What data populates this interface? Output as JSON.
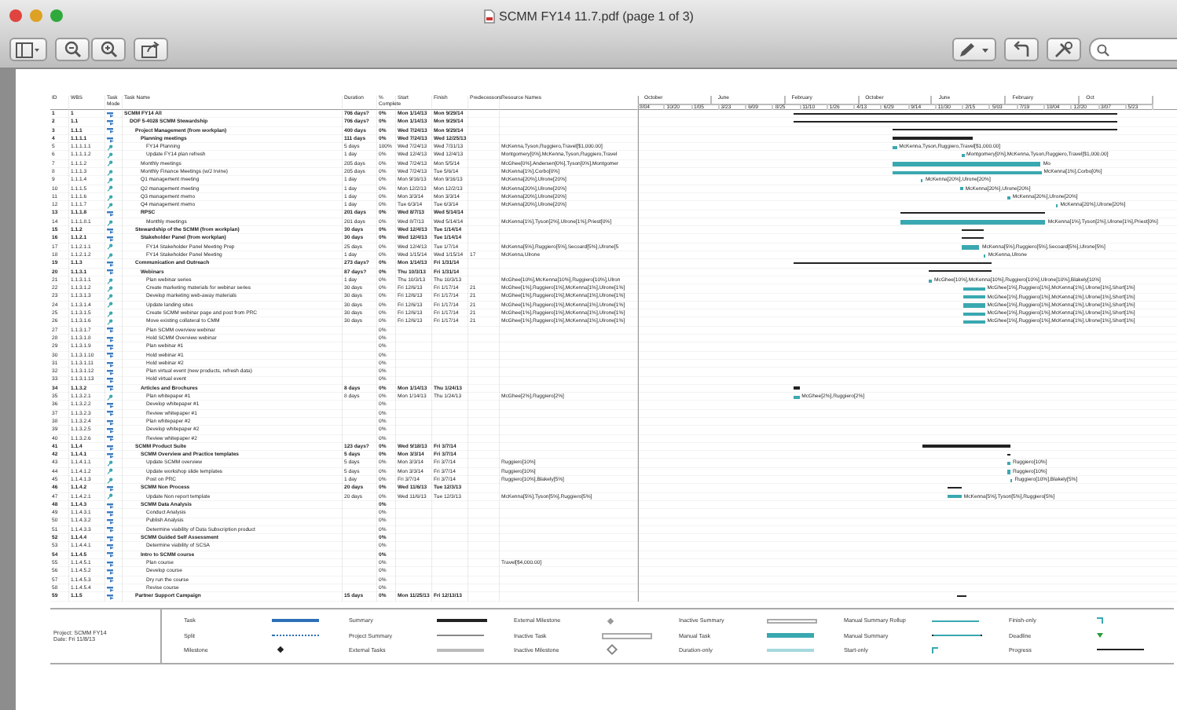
{
  "window": {
    "title": "SCMM FY14 11.7.pdf (page 1 of 3)"
  },
  "table": {
    "columns": {
      "id": "ID",
      "wbs": "WBS",
      "mode": "Task Mode",
      "name": "Task Name",
      "duration": "Duration",
      "complete": "% Complete",
      "start": "Start",
      "finish": "Finish",
      "pred": "Predecessors",
      "resources": "Resource Names"
    },
    "timescale": {
      "major": [
        "October",
        "June",
        "February",
        "October",
        "June",
        "February",
        "Oct"
      ],
      "minor": [
        "8/04",
        "10/20",
        "1/05",
        "3/23",
        "6/09",
        "8/25",
        "11/10",
        "1/26",
        "4/13",
        "6/29",
        "9/14",
        "11/30",
        "2/15",
        "5/03",
        "7/19",
        "10/04",
        "12/20",
        "3/07",
        "5/23"
      ]
    },
    "tasks": [
      {
        "id": "1",
        "wbs": "1",
        "kind": "auto",
        "name": "SCMM FY14 All",
        "duration": "706 days?",
        "complete": "0%",
        "start": "Mon 1/14/13",
        "finish": "Mon 9/29/14",
        "children": [
          {
            "id": "2",
            "wbs": "1.1",
            "kind": "auto",
            "name": "DOF 5-4028 SCMM Stewardship",
            "duration": "706 days?",
            "complete": "0%",
            "start": "Mon 1/14/13",
            "finish": "Mon 9/29/14",
            "children": [
              {
                "id": "3",
                "wbs": "1.1.1",
                "kind": "auto",
                "name": "Project Management (from workplan)",
                "duration": "400 days",
                "complete": "0%",
                "start": "Wed 7/24/13",
                "finish": "Mon 9/29/14",
                "children": [
                  {
                    "id": "4",
                    "wbs": "1.1.1.1",
                    "kind": "auto",
                    "name": "Planning meetings",
                    "duration": "111 days",
                    "complete": "0%",
                    "start": "Wed 7/24/13",
                    "finish": "Wed 12/25/13",
                    "children": [
                      {
                        "id": "5",
                        "wbs": "1.1.1.1.1",
                        "kind": "manual",
                        "name": "FY14 Planning",
                        "duration": "5 days",
                        "complete": "100%",
                        "start": "Wed 7/24/13",
                        "finish": "Wed 7/31/13",
                        "resources": "McKenna,Tyson,Ruggiero,Travel[$1,000.00]",
                        "bar_label": "McKenna,Tyson,Ruggiero,Travel[$1,000.00]"
                      },
                      {
                        "id": "6",
                        "wbs": "1.1.1.1.2",
                        "kind": "manual",
                        "name": "Update FY14 plan refresh",
                        "duration": "1 day",
                        "complete": "0%",
                        "start": "Wed 12/4/13",
                        "finish": "Wed 12/4/13",
                        "resources": "Montgomery[0%],McKenna,Tyson,Ruggiero,Travel",
                        "bar_label": "Montgomery[0%],McKenna,Tyson,Ruggiero,Travel[$1,000.00]"
                      }
                    ]
                  },
                  {
                    "id": "7",
                    "wbs": "1.1.1.2",
                    "kind": "manual",
                    "name": "Monthly meetings",
                    "duration": "205 days",
                    "complete": "0%",
                    "start": "Wed 7/24/13",
                    "finish": "Mon 5/5/14",
                    "resources": "McGhee[0%],Andersen[0%],Tyson[0%],Montgomer",
                    "bar_label": "Mo"
                  },
                  {
                    "id": "8",
                    "wbs": "1.1.1.3",
                    "kind": "manual",
                    "name": "Monthly Finance Meetings (w/J Irvine)",
                    "duration": "205 days",
                    "complete": "0%",
                    "start": "Wed 7/24/13",
                    "finish": "Tue 5/6/14",
                    "resources": "McKenna[1%],Corbo[0%]",
                    "bar_label": "McKenna[1%],Corbo[0%]"
                  },
                  {
                    "id": "9",
                    "wbs": "1.1.1.4",
                    "kind": "manual",
                    "name": "Q1 management meeting",
                    "duration": "1 day",
                    "complete": "0%",
                    "start": "Mon 9/16/13",
                    "finish": "Mon 9/16/13",
                    "resources": "McKenna[20%],Ulrone[20%]",
                    "bar_label": "McKenna[20%],Ulrone[20%]"
                  },
                  {
                    "id": "10",
                    "wbs": "1.1.1.5",
                    "kind": "manual",
                    "name": "Q2 management meeting",
                    "duration": "1 day",
                    "complete": "0%",
                    "start": "Mon 12/2/13",
                    "finish": "Mon 12/2/13",
                    "resources": "McKenna[20%],Ulrone[20%]",
                    "bar_label": "McKenna[20%],Ulrone[20%]"
                  },
                  {
                    "id": "11",
                    "wbs": "1.1.1.6",
                    "kind": "manual",
                    "name": "Q3 management memo",
                    "duration": "1 day",
                    "complete": "0%",
                    "start": "Mon 3/3/14",
                    "finish": "Mon 3/3/14",
                    "resources": "McKenna[20%],Ulrone[20%]",
                    "bar_label": "McKenna[20%],Ulrone[20%]"
                  },
                  {
                    "id": "12",
                    "wbs": "1.1.1.7",
                    "kind": "manual",
                    "name": "Q4 management memo",
                    "duration": "1 day",
                    "complete": "0%",
                    "start": "Tue 6/3/14",
                    "finish": "Tue 6/3/14",
                    "resources": "McKenna[20%],Ulrone[20%]",
                    "bar_label": "McKenna[20%],Ulrone[20%]"
                  },
                  {
                    "id": "13",
                    "wbs": "1.1.1.8",
                    "kind": "auto",
                    "name": "RPSC",
                    "duration": "201 days",
                    "complete": "0%",
                    "start": "Wed 8/7/13",
                    "finish": "Wed 5/14/14",
                    "children": [
                      {
                        "id": "14",
                        "wbs": "1.1.1.8.1",
                        "kind": "manual",
                        "name": "Monthly meetings",
                        "duration": "201 days",
                        "complete": "0%",
                        "start": "Wed 8/7/13",
                        "finish": "Wed 5/14/14",
                        "resources": "McKenna[1%],Tyson[2%],Ulrone[1%],Priest[0%]",
                        "bar_label": "McKenna[1%],Tyson[2%],Ulrone[1%],Priest[0%]"
                      }
                    ]
                  }
                ]
              },
              {
                "id": "15",
                "wbs": "1.1.2",
                "kind": "auto",
                "name": "Stewardship of the SCMM (from workplan)",
                "duration": "30 days",
                "complete": "0%",
                "start": "Wed 12/4/13",
                "finish": "Tue 1/14/14",
                "children": [
                  {
                    "id": "16",
                    "wbs": "1.1.2.1",
                    "kind": "auto",
                    "name": "Stakeholder Panel (from workplan)",
                    "duration": "30 days",
                    "complete": "0%",
                    "start": "Wed 12/4/13",
                    "finish": "Tue 1/14/14",
                    "children": [
                      {
                        "id": "17",
                        "wbs": "1.1.2.1.1",
                        "kind": "manual",
                        "name": "FY14 Stakeholder Panel Meeting Prep",
                        "duration": "25 days",
                        "complete": "0%",
                        "start": "Wed 12/4/13",
                        "finish": "Tue 1/7/14",
                        "resources": "McKenna[5%],Ruggiero[5%],Secoard[5%],Ulrone[5",
                        "bar_label": "McKenna[5%],Ruggiero[5%],Secoard[5%],Ulrone[5%]"
                      },
                      {
                        "id": "18",
                        "wbs": "1.1.2.1.2",
                        "kind": "manual",
                        "name": "FY14 Stakeholder Panel Meeting",
                        "duration": "1 day",
                        "complete": "0%",
                        "start": "Wed 1/15/14",
                        "finish": "Wed 1/15/14",
                        "pred": "17",
                        "resources": "McKenna,Ulrone",
                        "bar_label": "McKenna,Ulrone"
                      }
                    ]
                  }
                ]
              },
              {
                "id": "19",
                "wbs": "1.1.3",
                "kind": "auto",
                "name": "Communication and Outreach",
                "duration": "273 days?",
                "complete": "0%",
                "start": "Mon 1/14/13",
                "finish": "Fri 1/31/14",
                "children": [
                  {
                    "id": "20",
                    "wbs": "1.1.3.1",
                    "kind": "auto",
                    "name": "Webinars",
                    "duration": "87 days?",
                    "complete": "0%",
                    "start": "Thu 10/3/13",
                    "finish": "Fri 1/31/14",
                    "children": [
                      {
                        "id": "21",
                        "wbs": "1.1.3.1.1",
                        "kind": "manual",
                        "name": "Plan webinar series",
                        "duration": "1 day",
                        "complete": "0%",
                        "start": "Thu 10/3/13",
                        "finish": "Thu 10/3/13",
                        "resources": "McGhee[10%],McKenna[10%],Ruggiero[10%],Ulron",
                        "bar_label": "McGhee[10%],McKenna[10%],Ruggiero[10%],Ulrone[10%],Blakely[10%]"
                      },
                      {
                        "id": "22",
                        "wbs": "1.1.3.1.2",
                        "kind": "manual",
                        "name": "Create marketing materials for webinar series",
                        "duration": "30 days",
                        "complete": "0%",
                        "start": "Fri 12/6/13",
                        "finish": "Fri 1/17/14",
                        "pred": "21",
                        "resources": "McGhee[1%],Ruggiero[1%],McKenna[1%],Ulrone[1%]",
                        "bar_label": "McGhee[1%],Ruggiero[1%],McKenna[1%],Ulrone[1%],Short[1%]"
                      },
                      {
                        "id": "23",
                        "wbs": "1.1.3.1.3",
                        "kind": "manual",
                        "name": "Develop marketing web-away materials",
                        "duration": "30 days",
                        "complete": "0%",
                        "start": "Fri 12/6/13",
                        "finish": "Fri 1/17/14",
                        "pred": "21",
                        "resources": "McGhee[1%],Ruggiero[1%],McKenna[1%],Ulrone[1%]",
                        "bar_label": "McGhee[1%],Ruggiero[1%],McKenna[1%],Ulrone[1%],Short[1%]"
                      },
                      {
                        "id": "24",
                        "wbs": "1.1.3.1.4",
                        "kind": "manual",
                        "name": "Update landing sites",
                        "duration": "30 days",
                        "complete": "0%",
                        "start": "Fri 12/6/13",
                        "finish": "Fri 1/17/14",
                        "pred": "21",
                        "resources": "McGhee[1%],Ruggiero[1%],McKenna[1%],Ulrone[1%]",
                        "bar_label": "McGhee[1%],Ruggiero[1%],McKenna[1%],Ulrone[1%],Short[1%]"
                      },
                      {
                        "id": "25",
                        "wbs": "1.1.3.1.5",
                        "kind": "manual",
                        "name": "Create SCMM webinar page and post from PRC",
                        "duration": "30 days",
                        "complete": "0%",
                        "start": "Fri 12/6/13",
                        "finish": "Fri 1/17/14",
                        "pred": "21",
                        "resources": "McGhee[1%],Ruggiero[1%],McKenna[1%],Ulrone[1%]",
                        "bar_label": "McGhee[1%],Ruggiero[1%],McKenna[1%],Ulrone[1%],Short[1%]"
                      },
                      {
                        "id": "26",
                        "wbs": "1.1.3.1.6",
                        "kind": "manual",
                        "name": "Move existing collateral to CMM",
                        "duration": "30 days",
                        "complete": "0%",
                        "start": "Fri 12/6/13",
                        "finish": "Fri 1/17/14",
                        "pred": "21",
                        "resources": "McGhee[1%],Ruggiero[1%],McKenna[1%],Ulrone[1%]",
                        "bar_label": "McGhee[1%],Ruggiero[1%],McKenna[1%],Ulrone[1%],Short[1%]"
                      },
                      {
                        "id": "27",
                        "wbs": "1.1.3.1.7",
                        "kind": "auto",
                        "name": "Plan SCMM overview webinar",
                        "complete": "0%"
                      },
                      {
                        "id": "28",
                        "wbs": "1.1.3.1.8",
                        "kind": "auto",
                        "name": "Hold SCMM Overview webinar",
                        "complete": "0%"
                      },
                      {
                        "id": "29",
                        "wbs": "1.1.3.1.9",
                        "kind": "auto",
                        "name": "Plan webinar #1",
                        "complete": "0%"
                      },
                      {
                        "id": "30",
                        "wbs": "1.1.3.1.10",
                        "kind": "auto",
                        "name": "Hold webinar #1",
                        "complete": "0%"
                      },
                      {
                        "id": "31",
                        "wbs": "1.1.3.1.11",
                        "kind": "auto",
                        "name": "Hold webinar #2",
                        "complete": "0%"
                      },
                      {
                        "id": "32",
                        "wbs": "1.1.3.1.12",
                        "kind": "auto",
                        "name": "Plan virtual event (new products, refresh data)",
                        "complete": "0%"
                      },
                      {
                        "id": "33",
                        "wbs": "1.1.3.1.13",
                        "kind": "auto",
                        "name": "Hold virtual event",
                        "complete": "0%"
                      }
                    ]
                  },
                  {
                    "id": "34",
                    "wbs": "1.1.3.2",
                    "kind": "auto",
                    "name": "Articles and Brochures",
                    "duration": "8 days",
                    "complete": "0%",
                    "start": "Mon 1/14/13",
                    "finish": "Thu 1/24/13",
                    "children": [
                      {
                        "id": "35",
                        "wbs": "1.1.3.2.1",
                        "kind": "manual",
                        "name": "Plan whitepaper #1",
                        "duration": "8 days",
                        "complete": "0%",
                        "start": "Mon 1/14/13",
                        "finish": "Thu 1/24/13",
                        "resources": "McGhee[2%],Ruggiero[2%]",
                        "bar_label": "McGhee[2%],Ruggiero[2%]"
                      },
                      {
                        "id": "36",
                        "wbs": "1.1.3.2.2",
                        "kind": "auto",
                        "name": "Develop whitepaper #1",
                        "complete": "0%"
                      },
                      {
                        "id": "37",
                        "wbs": "1.1.3.2.3",
                        "kind": "auto",
                        "name": "Review whitepaper #1",
                        "complete": "0%"
                      },
                      {
                        "id": "38",
                        "wbs": "1.1.3.2.4",
                        "kind": "auto",
                        "name": "Plan whitepaper #2",
                        "complete": "0%"
                      },
                      {
                        "id": "39",
                        "wbs": "1.1.3.2.5",
                        "kind": "auto",
                        "name": "Develop whitepaper #2",
                        "complete": "0%"
                      },
                      {
                        "id": "40",
                        "wbs": "1.1.3.2.6",
                        "kind": "auto",
                        "name": "Review whitepaper #2",
                        "complete": "0%"
                      }
                    ]
                  }
                ]
              },
              {
                "id": "41",
                "wbs": "1.1.4",
                "kind": "auto",
                "name": "SCMM Product Suite",
                "duration": "123 days?",
                "complete": "0%",
                "start": "Wed 9/18/13",
                "finish": "Fri 3/7/14",
                "children": [
                  {
                    "id": "42",
                    "wbs": "1.1.4.1",
                    "kind": "auto",
                    "name": "SCMM Overview and Practice templates",
                    "duration": "5 days",
                    "complete": "0%",
                    "start": "Mon 3/3/14",
                    "finish": "Fri 3/7/14",
                    "children": [
                      {
                        "id": "43",
                        "wbs": "1.1.4.1.1",
                        "kind": "manual",
                        "name": "Update SCMM overview",
                        "duration": "5 days",
                        "complete": "0%",
                        "start": "Mon 3/3/14",
                        "finish": "Fri 3/7/14",
                        "resources": "Ruggiero[10%]",
                        "bar_label": "Ruggiero[10%]"
                      },
                      {
                        "id": "44",
                        "wbs": "1.1.4.1.2",
                        "kind": "manual",
                        "name": "Update workshop slide templates",
                        "duration": "5 days",
                        "complete": "0%",
                        "start": "Mon 3/3/14",
                        "finish": "Fri 3/7/14",
                        "resources": "Ruggiero[10%]",
                        "bar_label": "Ruggiero[10%]"
                      },
                      {
                        "id": "45",
                        "wbs": "1.1.4.1.3",
                        "kind": "manual",
                        "name": "Post on PRC",
                        "duration": "1 day",
                        "complete": "0%",
                        "start": "Fri 3/7/14",
                        "finish": "Fri 3/7/14",
                        "resources": "Ruggiero[10%],Blakely[5%]",
                        "bar_label": "Ruggiero[10%],Blakely[5%]"
                      }
                    ]
                  },
                  {
                    "id": "46",
                    "wbs": "1.1.4.2",
                    "kind": "auto",
                    "name": "SCMM Non Process",
                    "duration": "20 days",
                    "complete": "0%",
                    "start": "Wed 11/6/13",
                    "finish": "Tue 12/3/13",
                    "children": [
                      {
                        "id": "47",
                        "wbs": "1.1.4.2.1",
                        "kind": "manual",
                        "name": "Update Non report template",
                        "duration": "20 days",
                        "complete": "0%",
                        "start": "Wed 11/6/13",
                        "finish": "Tue 12/3/13",
                        "resources": "McKenna[5%],Tyson[5%],Ruggiero[5%]",
                        "bar_label": "McKenna[5%],Tyson[5%],Ruggiero[5%]"
                      }
                    ]
                  },
                  {
                    "id": "48",
                    "wbs": "1.1.4.3",
                    "kind": "auto",
                    "name": "SCMM Data Analysis",
                    "complete": "0%",
                    "children": [
                      {
                        "id": "49",
                        "wbs": "1.1.4.3.1",
                        "kind": "auto",
                        "name": "Conduct Analysis",
                        "complete": "0%"
                      },
                      {
                        "id": "50",
                        "wbs": "1.1.4.3.2",
                        "kind": "auto",
                        "name": "Publish Analysis",
                        "complete": "0%"
                      },
                      {
                        "id": "51",
                        "wbs": "1.1.4.3.3",
                        "kind": "auto",
                        "name": "Determine viability of Data Subscription product",
                        "complete": "0%"
                      }
                    ]
                  },
                  {
                    "id": "52",
                    "wbs": "1.1.4.4",
                    "kind": "auto",
                    "name": "SCMM Guided Self Assessment",
                    "complete": "0%",
                    "children": [
                      {
                        "id": "53",
                        "wbs": "1.1.4.4.1",
                        "kind": "auto",
                        "name": "Determine viability of SCSA",
                        "complete": "0%"
                      }
                    ]
                  },
                  {
                    "id": "54",
                    "wbs": "1.1.4.5",
                    "kind": "auto",
                    "name": "Intro to SCMM course",
                    "complete": "0%",
                    "children": [
                      {
                        "id": "55",
                        "wbs": "1.1.4.5.1",
                        "kind": "auto",
                        "name": "Plan course",
                        "complete": "0%",
                        "resources": "Travel[$4,000.00]"
                      },
                      {
                        "id": "56",
                        "wbs": "1.1.4.5.2",
                        "kind": "auto",
                        "name": "Develop course",
                        "complete": "0%"
                      },
                      {
                        "id": "57",
                        "wbs": "1.1.4.5.3",
                        "kind": "auto",
                        "name": "Dry run the course",
                        "complete": "0%"
                      },
                      {
                        "id": "58",
                        "wbs": "1.1.4.5.4",
                        "kind": "auto",
                        "name": "Revise course",
                        "complete": "0%"
                      }
                    ]
                  }
                ]
              },
              {
                "id": "59",
                "wbs": "1.1.5",
                "kind": "auto",
                "name": "Partner Support Campaign",
                "duration": "15 days",
                "complete": "0%",
                "start": "Mon 11/25/13",
                "finish": "Fri 12/13/13",
                "summary": true
              }
            ]
          }
        ]
      }
    ]
  },
  "footer": {
    "project": "Project: SCMM FY14",
    "date": "Date: Fri 11/8/13",
    "legend": [
      {
        "label": "Task",
        "kind": "task"
      },
      {
        "label": "Split",
        "kind": "split"
      },
      {
        "label": "Milestone",
        "kind": "milestone"
      },
      {
        "label": "Summary",
        "kind": "summary"
      },
      {
        "label": "Project Summary",
        "kind": "project_summary"
      },
      {
        "label": "External Tasks",
        "kind": "external_task"
      },
      {
        "label": "External Milestone",
        "kind": "external_milestone"
      },
      {
        "label": "Inactive Task",
        "kind": "inactive_task"
      },
      {
        "label": "Inactive Milestone",
        "kind": "inactive_milestone"
      },
      {
        "label": "Inactive Summary",
        "kind": "inactive_summary"
      },
      {
        "label": "Manual Task",
        "kind": "manual_task"
      },
      {
        "label": "Duration-only",
        "kind": "duration_only"
      },
      {
        "label": "Manual Summary Rollup",
        "kind": "manual_rollup"
      },
      {
        "label": "Manual Summary",
        "kind": "manual_summary"
      },
      {
        "label": "Start-only",
        "kind": "start_only"
      },
      {
        "label": "Finish-only",
        "kind": "finish_only"
      },
      {
        "label": "Deadline",
        "kind": "deadline"
      },
      {
        "label": "Progress",
        "kind": "progress"
      }
    ]
  }
}
